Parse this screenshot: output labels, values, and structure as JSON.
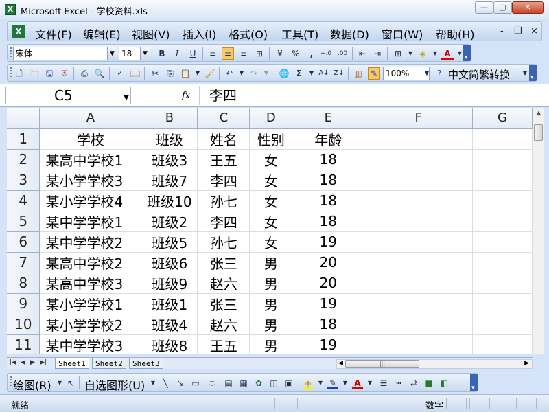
{
  "window": {
    "title": "Microsoft Excel - 学校资料.xls",
    "app_icon": "X"
  },
  "menubar": {
    "items": [
      "文件(F)",
      "编辑(E)",
      "视图(V)",
      "插入(I)",
      "格式(O)",
      "工具(T)",
      "数据(D)",
      "窗口(W)",
      "帮助(H)"
    ],
    "mdi_minimize": "-",
    "mdi_restore": "ᵬ",
    "mdi_close": "×"
  },
  "format_toolbar": {
    "font_name": "宋体",
    "font_size": "18",
    "bold": "B",
    "italic": "I",
    "underline": "U",
    "percent": "%",
    "comma": ",",
    "inc_decimal": "+.0",
    "dec_decimal": ".00"
  },
  "standard_toolbar": {
    "zoom": "100%",
    "chinese_convert": "中文简繁转换"
  },
  "formula_bar": {
    "name_box": "C5",
    "fx_label": "fx",
    "formula_value": "李四"
  },
  "columns": [
    "A",
    "B",
    "C",
    "D",
    "E",
    "F",
    "G"
  ],
  "rows": [
    {
      "num": "1",
      "cells": [
        "学校",
        "班级",
        "姓名",
        "性别",
        "年龄"
      ]
    },
    {
      "num": "2",
      "cells": [
        "某高中学校1",
        "班级3",
        "王五",
        "女",
        "18"
      ]
    },
    {
      "num": "3",
      "cells": [
        "某小学学校3",
        "班级7",
        "李四",
        "女",
        "18"
      ]
    },
    {
      "num": "4",
      "cells": [
        "某小学学校4",
        "班级10",
        "孙七",
        "女",
        "18"
      ]
    },
    {
      "num": "5",
      "cells": [
        "某中学学校1",
        "班级2",
        "李四",
        "女",
        "18"
      ]
    },
    {
      "num": "6",
      "cells": [
        "某中学学校2",
        "班级5",
        "孙七",
        "女",
        "19"
      ]
    },
    {
      "num": "7",
      "cells": [
        "某高中学校2",
        "班级6",
        "张三",
        "男",
        "20"
      ]
    },
    {
      "num": "8",
      "cells": [
        "某高中学校3",
        "班级9",
        "赵六",
        "男",
        "20"
      ]
    },
    {
      "num": "9",
      "cells": [
        "某小学学校1",
        "班级1",
        "张三",
        "男",
        "19"
      ]
    },
    {
      "num": "10",
      "cells": [
        "某小学学校2",
        "班级4",
        "赵六",
        "男",
        "18"
      ]
    },
    {
      "num": "11",
      "cells": [
        "某中学学校3",
        "班级8",
        "王五",
        "男",
        "19"
      ]
    }
  ],
  "sheets": [
    "Sheet1",
    "Sheet2",
    "Sheet3"
  ],
  "draw_toolbar": {
    "draw_label": "绘图(R)",
    "autoshapes_label": "自选图形(U)"
  },
  "status": {
    "ready": "就绪",
    "num_lock": "数字"
  }
}
